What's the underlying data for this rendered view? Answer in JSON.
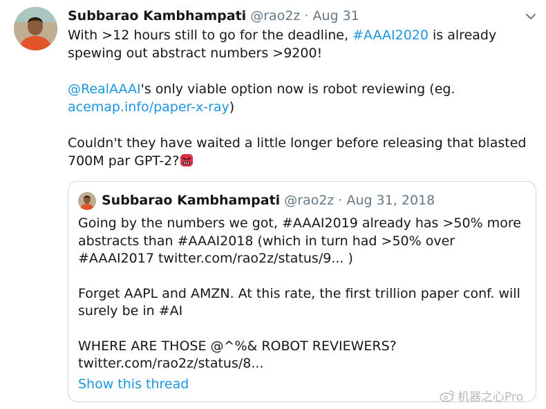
{
  "tweet": {
    "author_name": "Subbarao Kambhampati",
    "handle": "@rao2z",
    "separator": " · ",
    "date": "Aug 31",
    "line1_pre": "With >12 hours still to go for the deadline, ",
    "line1_hashtag": "#AAAI2020",
    "line1_post": " is  already spewing out abstract numbers >9200!",
    "line2_mention": "@RealAAAI",
    "line2_post": "'s only viable option now is robot reviewing (eg. ",
    "line2_link": "acemap.info/paper-x-ray",
    "line2_close": ")",
    "line3": "Couldn't they have waited a little longer before releasing that blasted 700M par GPT-2?",
    "emoji_icon": "angry-face-with-symbols-icon"
  },
  "quoted": {
    "author_name": "Subbarao Kambhampati",
    "handle": "@rao2z",
    "separator": " · ",
    "date": "Aug 31, 2018",
    "para1": "Going by the numbers we got, #AAAI2019 already has >50% more abstracts than #AAAI2018 (which in turn had >50% over #AAAI2017 twitter.com/rao2z/status/9... )",
    "para2": "Forget AAPL and AMZN. At this rate, the first trillion paper conf. will surely be in #AI",
    "para3": "WHERE ARE THOSE @^%& ROBOT REVIEWERS? twitter.com/rao2z/status/8...",
    "show_thread": "Show this thread"
  },
  "watermark": {
    "text": "机器之心Pro",
    "icon": "weibo-icon"
  },
  "colors": {
    "link": "#1b95e0",
    "muted": "#657786",
    "border": "#ccd6dd"
  }
}
